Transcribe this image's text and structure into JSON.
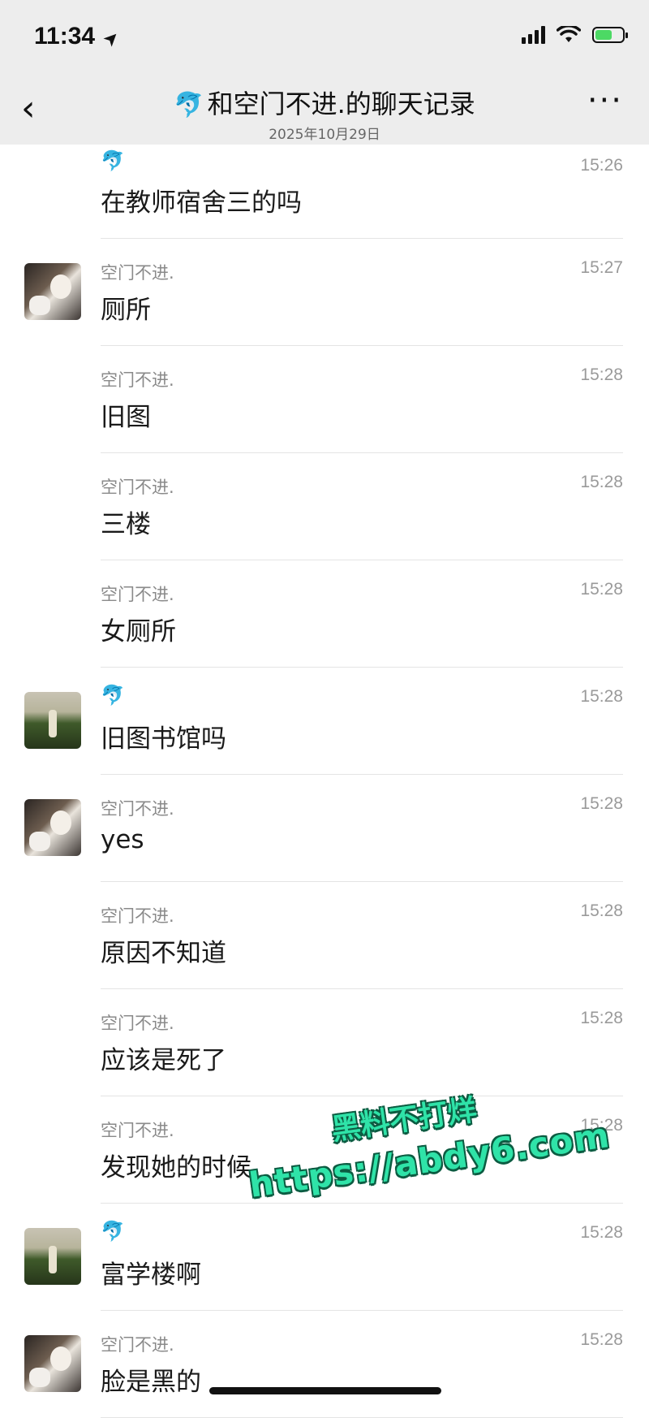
{
  "status_bar": {
    "time": "11:34",
    "location_arrow": "➤"
  },
  "header": {
    "back_icon": "‹",
    "title_emoji": "🐬",
    "title": "和空门不进.的聊天记录",
    "date": "2025年10月29日",
    "more_icon": "···"
  },
  "messages": [
    {
      "sender": "🐬",
      "time": "15:26",
      "text": "在教师宿舍三的吗",
      "avatar": "none"
    },
    {
      "sender": "空门不进.",
      "time": "15:27",
      "text": "厕所",
      "avatar": "a"
    },
    {
      "sender": "空门不进.",
      "time": "15:28",
      "text": "旧图",
      "avatar": "none"
    },
    {
      "sender": "空门不进.",
      "time": "15:28",
      "text": "三楼",
      "avatar": "none"
    },
    {
      "sender": "空门不进.",
      "time": "15:28",
      "text": "女厕所",
      "avatar": "none"
    },
    {
      "sender": "🐬",
      "time": "15:28",
      "text": "旧图书馆吗",
      "avatar": "b"
    },
    {
      "sender": "空门不进.",
      "time": "15:28",
      "text": "yes",
      "avatar": "a"
    },
    {
      "sender": "空门不进.",
      "time": "15:28",
      "text": "原因不知道",
      "avatar": "none"
    },
    {
      "sender": "空门不进.",
      "time": "15:28",
      "text": "应该是死了",
      "avatar": "none"
    },
    {
      "sender": "空门不进.",
      "time": "15:28",
      "text": "发现她的时候",
      "avatar": "none"
    },
    {
      "sender": "🐬",
      "time": "15:28",
      "text": "富学楼啊",
      "avatar": "b"
    },
    {
      "sender": "空门不进.",
      "time": "15:28",
      "text": "脸是黑的",
      "avatar": "a"
    }
  ],
  "watermark": {
    "line1": "黑料不打烊",
    "line2": "https://abdy6.com"
  },
  "colors": {
    "header_bg": "#ededed",
    "watermark": "#2fe3a8",
    "battery": "#4cd964"
  }
}
